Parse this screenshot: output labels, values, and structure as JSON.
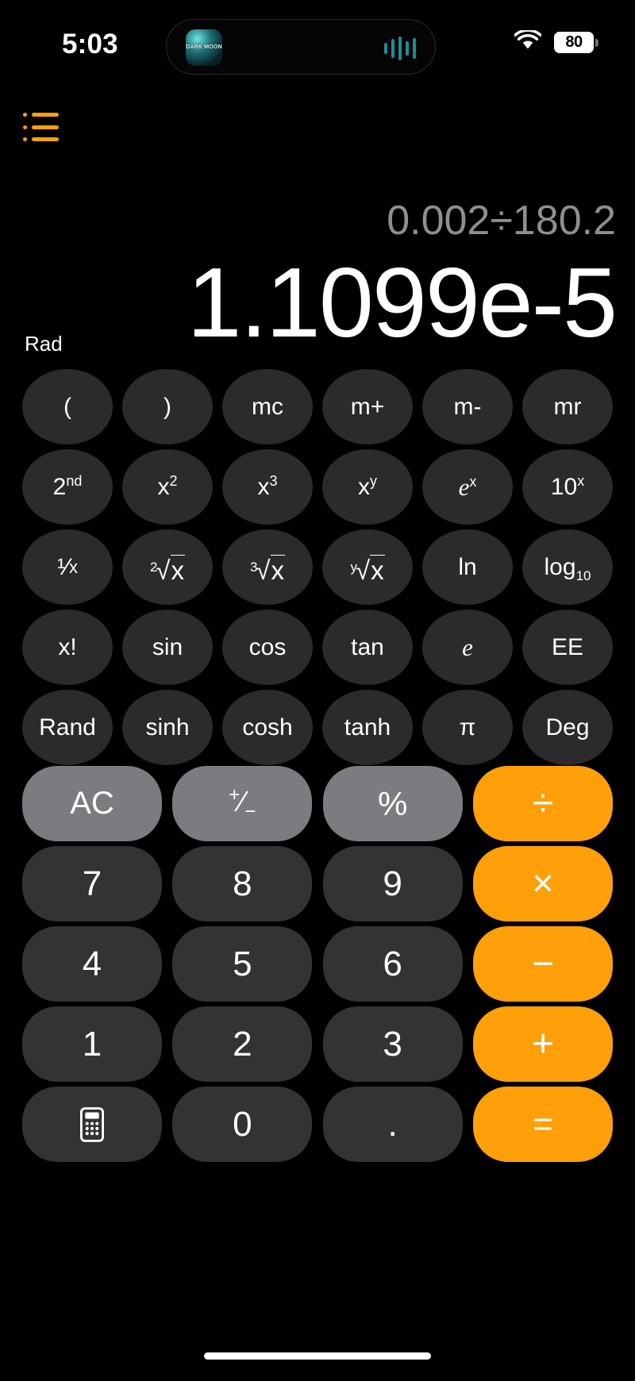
{
  "status_bar": {
    "time": "5:03",
    "battery_level": "80",
    "wifi_icon": "wifi-icon",
    "battery_icon": "battery-icon",
    "dynamic_island": {
      "app_name": "DARK MOON",
      "app_icon": "dark-moon-app-icon",
      "activity_icon": "audio-waveform-icon"
    }
  },
  "header": {
    "menu_icon": "list-menu-icon"
  },
  "display": {
    "expression": "0.002÷180.2",
    "result": "1.1099e-5",
    "angle_mode": "Rad"
  },
  "scientific_pad": {
    "rows": [
      [
        {
          "label": "(",
          "name": "open-paren-key"
        },
        {
          "label": ")",
          "name": "close-paren-key"
        },
        {
          "label": "mc",
          "name": "memory-clear-key"
        },
        {
          "label": "m+",
          "name": "memory-add-key"
        },
        {
          "label": "m-",
          "name": "memory-subtract-key"
        },
        {
          "label": "mr",
          "name": "memory-recall-key"
        }
      ],
      [
        {
          "label": "2nd",
          "name": "second-function-key",
          "base": "2",
          "sup": "nd"
        },
        {
          "label": "x²",
          "name": "square-key",
          "base": "x",
          "sup": "2"
        },
        {
          "label": "x³",
          "name": "cube-key",
          "base": "x",
          "sup": "3"
        },
        {
          "label": "xʸ",
          "name": "power-key",
          "base": "x",
          "sup": "y"
        },
        {
          "label": "eˣ",
          "name": "exp-e-key",
          "base": "e",
          "sup": "x",
          "italic": true
        },
        {
          "label": "10ˣ",
          "name": "exp-ten-key",
          "base": "10",
          "sup": "x"
        }
      ],
      [
        {
          "label": "1/x",
          "name": "reciprocal-key"
        },
        {
          "label": "²√x",
          "name": "square-root-key",
          "index": "2"
        },
        {
          "label": "³√x",
          "name": "cube-root-key",
          "index": "3"
        },
        {
          "label": "ʸ√x",
          "name": "nth-root-key",
          "index": "y"
        },
        {
          "label": "ln",
          "name": "natural-log-key"
        },
        {
          "label": "log10",
          "name": "log-base-ten-key",
          "base": "log",
          "sub": "10"
        }
      ],
      [
        {
          "label": "x!",
          "name": "factorial-key"
        },
        {
          "label": "sin",
          "name": "sine-key"
        },
        {
          "label": "cos",
          "name": "cosine-key"
        },
        {
          "label": "tan",
          "name": "tangent-key"
        },
        {
          "label": "e",
          "name": "euler-constant-key",
          "italic": true
        },
        {
          "label": "EE",
          "name": "scientific-notation-key"
        }
      ],
      [
        {
          "label": "Rand",
          "name": "random-key"
        },
        {
          "label": "sinh",
          "name": "hyperbolic-sine-key"
        },
        {
          "label": "cosh",
          "name": "hyperbolic-cosine-key"
        },
        {
          "label": "tanh",
          "name": "hyperbolic-tangent-key"
        },
        {
          "label": "π",
          "name": "pi-key"
        },
        {
          "label": "Deg",
          "name": "degree-mode-key"
        }
      ]
    ]
  },
  "main_pad": {
    "rows": [
      [
        {
          "label": "AC",
          "name": "all-clear-key",
          "style": "fn"
        },
        {
          "label": "+/-",
          "name": "sign-toggle-key",
          "style": "fn"
        },
        {
          "label": "%",
          "name": "percent-key",
          "style": "fn"
        },
        {
          "label": "÷",
          "name": "divide-key",
          "style": "op"
        }
      ],
      [
        {
          "label": "7",
          "name": "digit-7-key",
          "style": "num"
        },
        {
          "label": "8",
          "name": "digit-8-key",
          "style": "num"
        },
        {
          "label": "9",
          "name": "digit-9-key",
          "style": "num"
        },
        {
          "label": "×",
          "name": "multiply-key",
          "style": "op"
        }
      ],
      [
        {
          "label": "4",
          "name": "digit-4-key",
          "style": "num"
        },
        {
          "label": "5",
          "name": "digit-5-key",
          "style": "num"
        },
        {
          "label": "6",
          "name": "digit-6-key",
          "style": "num"
        },
        {
          "label": "−",
          "name": "subtract-key",
          "style": "op"
        }
      ],
      [
        {
          "label": "1",
          "name": "digit-1-key",
          "style": "num"
        },
        {
          "label": "2",
          "name": "digit-2-key",
          "style": "num"
        },
        {
          "label": "3",
          "name": "digit-3-key",
          "style": "num"
        },
        {
          "label": "+",
          "name": "add-key",
          "style": "op"
        }
      ],
      [
        {
          "label": "",
          "name": "calculator-icon-key",
          "style": "num",
          "icon": "calculator-icon"
        },
        {
          "label": "0",
          "name": "digit-0-key",
          "style": "num"
        },
        {
          "label": ".",
          "name": "decimal-point-key",
          "style": "num"
        },
        {
          "label": "=",
          "name": "equals-key",
          "style": "op eq"
        }
      ]
    ]
  },
  "colors": {
    "accent_orange": "#FF9F0A",
    "function_gray": "#7c7c80",
    "number_gray": "#333335",
    "sci_gray": "#2b2b2d",
    "expression_gray": "#8e8e93",
    "background": "#000000"
  },
  "home_indicator": "home-indicator"
}
